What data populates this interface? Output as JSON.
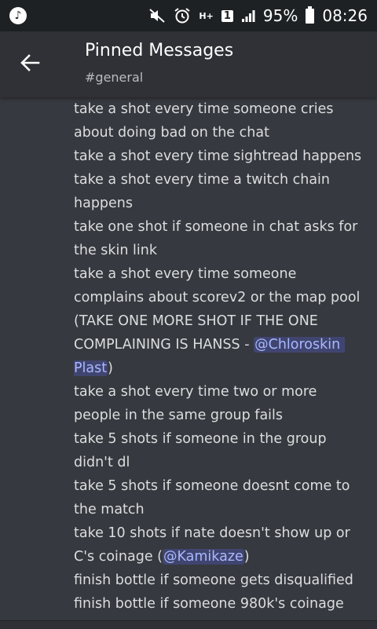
{
  "status_bar": {
    "battery_percent": "95%",
    "time": "08:26",
    "network_label": "H+",
    "sim_slot": "1"
  },
  "toolbar": {
    "title": "Pinned Messages",
    "channel": "#general"
  },
  "message": {
    "segments": [
      {
        "text": "take a shot every time someone cries about doing bad on the chat\ntake a shot every time sightread happens\ntake a shot every time a twitch chain happens\ntake one shot if someone in chat asks for the skin link\ntake a shot every time someone complains about scorev2 or the map pool (TAKE ONE MORE SHOT IF THE ONE COMPLAINING IS HANSS - "
      },
      {
        "mention": "@Chloroskin Plast"
      },
      {
        "text": ")\ntake a shot every time two or more people in the same group fails\ntake 5 shots if someone in the group didn't dl\ntake 5 shots if someone doesnt come to the match\ntake 10 shots if nate doesn't show up or C's coinage ("
      },
      {
        "mention": "@Kamikaze"
      },
      {
        "text": ")\nfinish bottle if someone gets disqualified\nfinish bottle if someone 980k's coinage"
      }
    ]
  },
  "icons": {
    "app": "music-note-icon",
    "mute": "mute-icon",
    "alarm": "alarm-icon",
    "signal": "signal-icon",
    "battery": "battery-icon",
    "back": "arrow-back-icon"
  },
  "colors": {
    "background": "#36393f",
    "toolbar": "#2f3136",
    "statusbar": "#1e2124",
    "text": "#dcddde",
    "mention_text": "#a9b8ff"
  }
}
